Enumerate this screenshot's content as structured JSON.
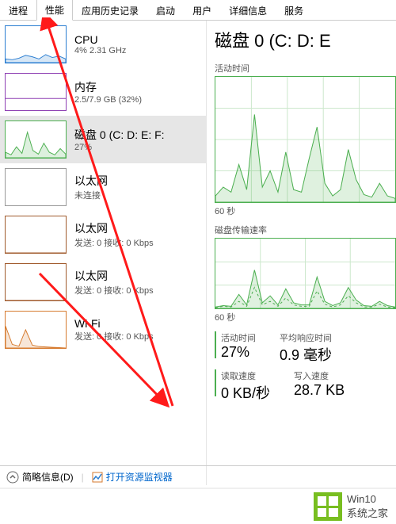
{
  "tabs": {
    "items": [
      "进程",
      "性能",
      "应用历史记录",
      "启动",
      "用户",
      "详细信息",
      "服务"
    ],
    "selected_index": 1
  },
  "sidebar": {
    "items": [
      {
        "title": "CPU",
        "sub": "4%  2.31 GHz",
        "color": "#2a7dd1",
        "selected": false
      },
      {
        "title": "内存",
        "sub": "2.5/7.9 GB (32%)",
        "color": "#8e3fb3",
        "selected": false
      },
      {
        "title": "磁盘 0 (C: D: E: F:",
        "sub": "27%",
        "color": "#4caf50",
        "selected": true
      },
      {
        "title": "以太网",
        "sub": "未连接",
        "color": "#999",
        "selected": false
      },
      {
        "title": "以太网",
        "sub": "发送: 0 接收: 0 Kbps",
        "color": "#a05a2c",
        "selected": false
      },
      {
        "title": "以太网",
        "sub": "发送: 0 接收: 0 Kbps",
        "color": "#a05a2c",
        "selected": false
      },
      {
        "title": "Wi-Fi",
        "sub": "发送: 0 接收: 0 Kbps",
        "color": "#d67a2e",
        "selected": false
      }
    ]
  },
  "main": {
    "title": "磁盘 0 (C: D: E",
    "active_time_label": "活动时间",
    "x_axis": "60 秒",
    "transfer_label": "磁盘传输速率",
    "stats": [
      {
        "label": "活动时间",
        "value": "27%",
        "accent": true
      },
      {
        "label": "平均响应时间",
        "value": "0.9 毫秒",
        "accent": false
      },
      {
        "label": "读取速度",
        "value": "0 KB/秒",
        "accent": true
      },
      {
        "label": "写入速度",
        "value": "28.7 KB",
        "accent": false
      }
    ]
  },
  "bottom": {
    "collapse": "简略信息(D)",
    "resmon": "打开资源监视器"
  },
  "watermark": {
    "line1": "Win10",
    "line2": "系统之家"
  },
  "chart_data": {
    "type": "line",
    "active_time_series": {
      "ylim": [
        0,
        100
      ],
      "xlabel": "60 秒",
      "values": [
        5,
        12,
        8,
        30,
        10,
        70,
        12,
        25,
        8,
        40,
        10,
        8,
        35,
        60,
        15,
        5,
        10,
        42,
        18,
        6,
        4,
        15,
        5,
        3
      ]
    },
    "transfer_rate_series": {
      "ylim": [
        0,
        100
      ],
      "xlabel": "60 秒",
      "read": [
        2,
        4,
        3,
        20,
        5,
        55,
        8,
        18,
        5,
        28,
        8,
        5,
        5,
        45,
        10,
        4,
        8,
        30,
        12,
        4,
        3,
        10,
        4,
        2
      ],
      "write": [
        1,
        3,
        2,
        10,
        3,
        30,
        5,
        10,
        3,
        15,
        5,
        3,
        3,
        25,
        6,
        2,
        5,
        18,
        8,
        2,
        2,
        6,
        2,
        1
      ]
    },
    "sidebar_thumbs": [
      {
        "name": "CPU",
        "values": [
          10,
          8,
          12,
          20,
          16,
          10,
          22,
          14,
          18,
          10
        ]
      },
      {
        "name": "内存",
        "values": [
          32
        ]
      },
      {
        "name": "磁盘",
        "values": [
          15,
          8,
          30,
          12,
          70,
          20,
          10,
          40,
          15,
          8,
          25,
          10
        ]
      },
      {
        "name": "以太网1",
        "values": []
      },
      {
        "name": "以太网2",
        "values": [
          0,
          0,
          0,
          0,
          0,
          0
        ]
      },
      {
        "name": "以太网3",
        "values": [
          0,
          0,
          0,
          0,
          0,
          0
        ]
      },
      {
        "name": "Wi-Fi",
        "values": [
          60,
          10,
          5,
          50,
          8,
          4,
          3,
          2,
          1,
          0
        ]
      }
    ]
  }
}
